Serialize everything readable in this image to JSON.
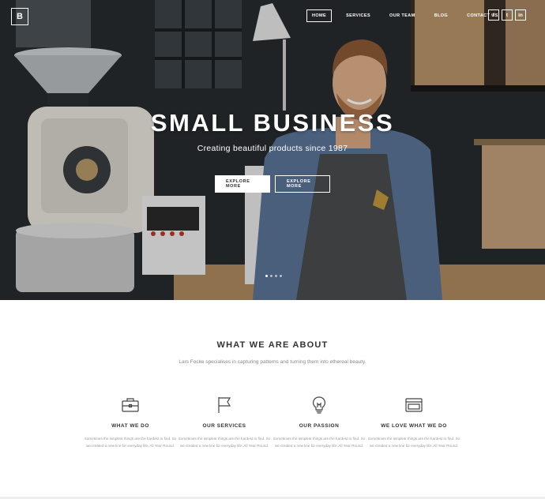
{
  "brand": {
    "logo_letter": "B"
  },
  "nav": {
    "items": [
      {
        "label": "Home",
        "active": true
      },
      {
        "label": "Services",
        "active": false
      },
      {
        "label": "Our Team",
        "active": false
      },
      {
        "label": "Blog",
        "active": false
      },
      {
        "label": "Contact Us",
        "active": false
      }
    ],
    "social": [
      {
        "label": "f",
        "icon": "facebook-icon"
      },
      {
        "label": "t",
        "icon": "twitter-icon"
      },
      {
        "label": "in",
        "icon": "linkedin-icon"
      }
    ]
  },
  "hero": {
    "title": "SMALL BUSINESS",
    "subtitle": "Creating beautiful products since 1987",
    "primary_button": "Explore More",
    "secondary_button": "Explore More",
    "slides": {
      "count": 4,
      "active": 1
    }
  },
  "about": {
    "title": "WHAT WE ARE ABOUT",
    "text": "Lars Focke specialises in capturing patterns and turning them into ethereal beauty.",
    "features": [
      {
        "icon": "briefcase-icon",
        "title": "What we do",
        "text": "Sometimes the simplest things are the hardest to find. So we created a new line for everyday life. All Year Round."
      },
      {
        "icon": "flag-icon",
        "title": "Our services",
        "text": "Sometimes the simplest things are the hardest to find. So we created a new line for everyday life. All Year Round."
      },
      {
        "icon": "lightbulb-icon",
        "title": "Our passion",
        "text": "Sometimes the simplest things are the hardest to find. So we created a new line for everyday life. All Year Round."
      },
      {
        "icon": "browser-window-icon",
        "title": "We love what we do",
        "text": "Sometimes the simplest things are the hardest to find. So we created a new line for everyday life. All Year Round."
      }
    ]
  },
  "colors": {
    "hero_dark": "#23282b",
    "text_dark": "#333333",
    "text_muted": "#999999",
    "white": "#ffffff"
  }
}
